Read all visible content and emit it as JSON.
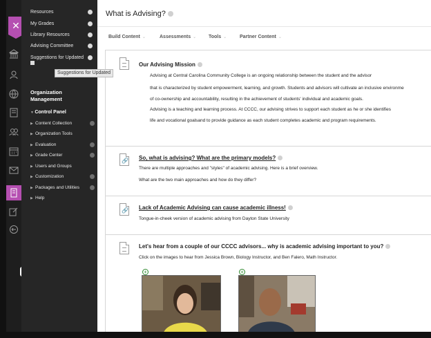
{
  "menu": {
    "items": [
      {
        "label": "Resources"
      },
      {
        "label": "My Grades"
      },
      {
        "label": "Library Resources"
      },
      {
        "label": "Advising Committee"
      },
      {
        "label": "Suggestions for Updated"
      }
    ],
    "tooltip": "Suggestions for Updated",
    "org_heading": "Organization Management",
    "control_panel": "Control Panel",
    "control_items": [
      {
        "label": "Content Collection"
      },
      {
        "label": "Organization Tools"
      },
      {
        "label": "Evaluation"
      },
      {
        "label": "Grade Center"
      },
      {
        "label": "Users and Groups"
      },
      {
        "label": "Customization"
      },
      {
        "label": "Packages and Utilities"
      },
      {
        "label": "Help"
      }
    ]
  },
  "page": {
    "title": "What is Advising?"
  },
  "toolbar": {
    "build": "Build Content",
    "assessments": "Assessments",
    "tools": "Tools",
    "partner": "Partner Content"
  },
  "items": {
    "mission": {
      "title": "Our Advising Mission",
      "lines": [
        "Advising at Central Carolina Community College is an ongoing relationship between the student and the advisor",
        "that is characterized by student empowerment, learning, and growth. Students and advisors will cultivate an inclusive environme",
        "of co-ownership and accountability, resulting in the achievement of students' individual and academic goals.",
        "Advising is a teaching and learning process. At CCCC, our advising strives to support each student as he or she identifies",
        "life and vocational goalsand to provide guidance as each student completes academic and program requirements."
      ]
    },
    "primary": {
      "title": "So, what is advising? What are the primary models?",
      "lines": [
        "There are multiple approaches and \"styles\" of academic advising.  Here is a brief overview.",
        "What are the two main approaches and how do they differ?"
      ]
    },
    "lack": {
      "title": "Lack of Academic Advising can cause academic illness!",
      "lines": [
        "Tongue-in-cheek version of academic advising from Dayton State University"
      ]
    },
    "advisors": {
      "title": "Let's hear from a couple of our CCCC advisors... why is academic advising important to you?",
      "lines": [
        "Click on the images to hear from Jessica Brown, Biology Instructor, and Ben Falero, Math Instructor."
      ]
    }
  },
  "colors": {
    "accent": "#b54fb1",
    "menu_bg": "#262626",
    "rail_bg": "#1e1e1e"
  },
  "icons": [
    "close-icon",
    "institution-icon",
    "user-icon",
    "globe-icon",
    "calendar-icon",
    "people-icon",
    "mail-icon",
    "grades-icon",
    "edit-icon",
    "signout-icon",
    "play-icon",
    "document-icon",
    "link-icon",
    "add-icon"
  ]
}
